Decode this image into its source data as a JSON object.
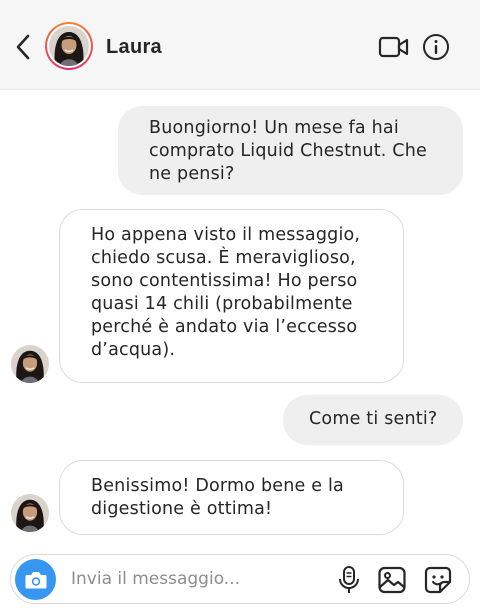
{
  "header": {
    "contact_name": "Laura",
    "back_icon": "chevron-left-icon",
    "video_icon": "video-camera-icon",
    "info_icon": "info-icon"
  },
  "messages": [
    {
      "direction": "outgoing",
      "lines": [
        "Buongiorno! Un mese fa hai",
        "comprato Liquid Chestnut. Che",
        "ne pensi?"
      ]
    },
    {
      "direction": "incoming",
      "lines": [
        "Ho appena visto il messaggio,",
        "chiedo scusa. È meraviglioso,",
        "sono contentissima! Ho perso",
        "quasi 14 chili (probabilmente",
        "perché è andato via l’eccesso",
        "d’acqua)."
      ]
    },
    {
      "direction": "outgoing",
      "lines": [
        "Come ti senti?"
      ]
    },
    {
      "direction": "incoming",
      "lines": [
        "Benissimo! Dormo bene e la",
        "digestione è ottima!"
      ]
    }
  ],
  "composer": {
    "placeholder": "Invia il messaggio...",
    "camera_icon": "camera-icon",
    "mic_icon": "microphone-icon",
    "gallery_icon": "gallery-icon",
    "sticker_icon": "sticker-icon"
  },
  "colors": {
    "accent": "#3797f0",
    "outgoing_bubble": "#efefef",
    "header_bg": "#f6f6f6"
  }
}
